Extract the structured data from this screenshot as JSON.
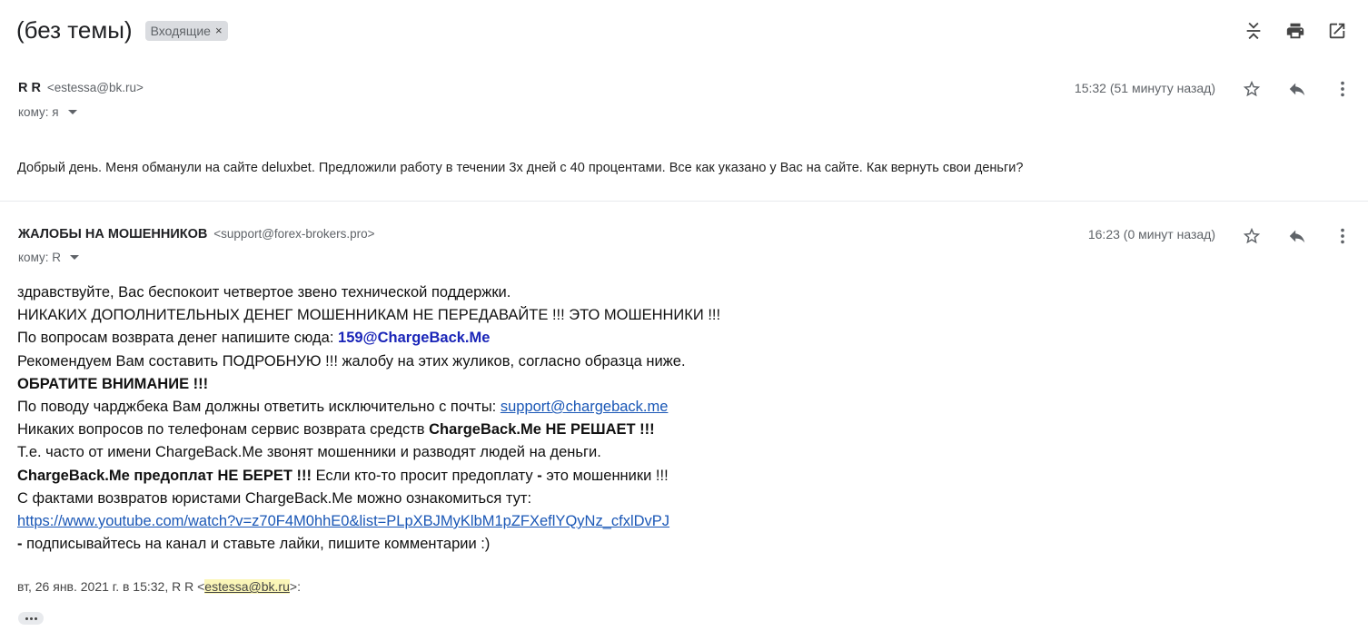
{
  "subject": "(без темы)",
  "label_chip": "Входящие",
  "label_close": "×",
  "messages": [
    {
      "sender": "R R",
      "email": "<estessa@bk.ru>",
      "to": "кому: я",
      "time": "15:32 (51 минуту назад)",
      "body": "Добрый день. Меня обманули на сайте deluxbet. Предложили работу в течении 3х дней с 40 процентами. Все как указано у Вас на сайте. Как вернуть свои деньги?"
    },
    {
      "sender": "ЖАЛОБЫ НА МОШЕННИКОВ",
      "email": "<support@forex-brokers.pro>",
      "to": "кому: R",
      "time": "16:23 (0 минут назад)",
      "lines": {
        "l1": "здравствуйте, Вас беспокоит четвертое звено технической поддержки.",
        "l2": "НИКАКИХ ДОПОЛНИТЕЛЬНЫХ ДЕНЕГ МОШЕННИКАМ НЕ ПЕРЕДАВАЙТЕ !!! ЭТО МОШЕННИКИ !!!",
        "l3a": "По вопросам возврата денег напишите сюда: ",
        "l3b": "159@ChargeBack.Me",
        "l4": "Рекомендуем Вам составить ПОДРОБНУЮ !!! жалобу на этих жуликов, согласно образца ниже.",
        "l5": "ОБРАТИТЕ ВНИМАНИЕ !!!",
        "l6a": "По поводу чарджбека Вам должны ответить исключительно с почты: ",
        "l6b": "support@chargeback.me",
        "l7a": "Никаких вопросов по телефонам сервис возврата средств ",
        "l7b": "ChargeBack.Me НЕ РЕШАЕТ !!!",
        "l8": "Т.е. часто от имени ChargeBack.Me звонят мошенники и разводят людей на деньги.",
        "l9a": "ChargeBack.Me предоплат НЕ БЕРЕТ !!!",
        "l9b": " Если кто-то просит предоплату ",
        "l9c": "-",
        "l9d": " это мошенники !!!",
        "l10": "С фактами возвратов юристами ChargeBack.Me можно ознакомиться тут:",
        "l11": "https://www.youtube.com/watch?v=z70F4M0hhE0&list=PLpXBJMyKlbM1pZFXeflYQyNz_cfxlDvPJ",
        "l12a": " -",
        "l12b": " подписывайтесь на канал и ставьте лайки, пишите комментарии :)"
      },
      "quote": {
        "prefix": "вт, 26 янв. 2021 г. в 15:32, R R <",
        "email": "estessa@bk.ru",
        "suffix": ">:"
      }
    }
  ],
  "icons": {
    "expand": "expand-collapse-icon",
    "print": "print-icon",
    "open": "open-new-window-icon",
    "star": "star-icon",
    "reply": "reply-icon",
    "more": "more-vert-icon"
  }
}
